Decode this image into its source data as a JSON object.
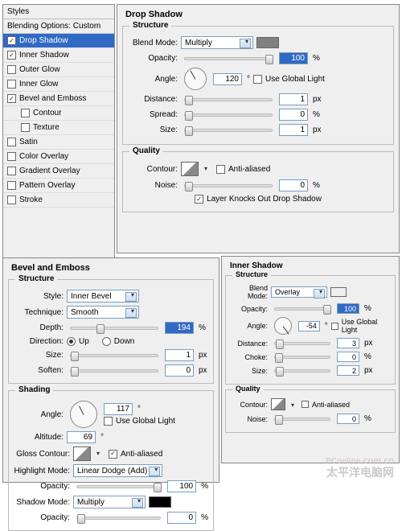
{
  "sidebar": {
    "header": "Styles",
    "blending": "Blending Options: Custom",
    "items": [
      {
        "label": "Drop Shadow",
        "checked": true,
        "selected": true,
        "indent": false
      },
      {
        "label": "Inner Shadow",
        "checked": true,
        "selected": false,
        "indent": false
      },
      {
        "label": "Outer Glow",
        "checked": false,
        "selected": false,
        "indent": false
      },
      {
        "label": "Inner Glow",
        "checked": false,
        "selected": false,
        "indent": false
      },
      {
        "label": "Bevel and Emboss",
        "checked": true,
        "selected": false,
        "indent": false
      },
      {
        "label": "Contour",
        "checked": false,
        "selected": false,
        "indent": true
      },
      {
        "label": "Texture",
        "checked": false,
        "selected": false,
        "indent": true
      },
      {
        "label": "Satin",
        "checked": false,
        "selected": false,
        "indent": false
      },
      {
        "label": "Color Overlay",
        "checked": false,
        "selected": false,
        "indent": false
      },
      {
        "label": "Gradient Overlay",
        "checked": false,
        "selected": false,
        "indent": false
      },
      {
        "label": "Pattern Overlay",
        "checked": false,
        "selected": false,
        "indent": false
      },
      {
        "label": "Stroke",
        "checked": false,
        "selected": false,
        "indent": false
      }
    ]
  },
  "dropShadow": {
    "title": "Drop Shadow",
    "structure": {
      "title": "Structure",
      "blendModeLabel": "Blend Mode:",
      "blendMode": "Multiply",
      "color": "#808080",
      "opacityLabel": "Opacity:",
      "opacity": "100",
      "pct": "%",
      "angleLabel": "Angle:",
      "angle": "120",
      "deg": "°",
      "useGlobalLabel": "Use Global Light",
      "useGlobal": false,
      "distanceLabel": "Distance:",
      "distance": "1",
      "spreadLabel": "Spread:",
      "spread": "0",
      "sizeLabel": "Size:",
      "size": "1",
      "px": "px"
    },
    "quality": {
      "title": "Quality",
      "contourLabel": "Contour:",
      "antiAliasedLabel": "Anti-aliased",
      "antiAliased": false,
      "noiseLabel": "Noise:",
      "noise": "0",
      "knockoutLabel": "Layer Knocks Out Drop Shadow",
      "knockout": true
    }
  },
  "bevel": {
    "title": "Bevel and Emboss",
    "structure": {
      "title": "Structure",
      "styleLabel": "Style:",
      "style": "Inner Bevel",
      "techLabel": "Technique:",
      "tech": "Smooth",
      "depthLabel": "Depth:",
      "depth": "194",
      "dirLabel": "Direction:",
      "up": "Up",
      "down": "Down",
      "sizeLabel": "Size:",
      "size": "1",
      "softenLabel": "Soften:",
      "soften": "0",
      "px": "px",
      "pct": "%"
    },
    "shading": {
      "title": "Shading",
      "angleLabel": "Angle:",
      "angle": "117",
      "useGlobalLabel": "Use Global Light",
      "useGlobal": false,
      "altitudeLabel": "Altitude:",
      "altitude": "69",
      "glossLabel": "Gloss Contour:",
      "antiAliasedLabel": "Anti-aliased",
      "antiAliased": true,
      "hlModeLabel": "Highlight Mode:",
      "hlMode": "Linear Dodge (Add)",
      "opacityLabel": "Opacity:",
      "hlOpacity": "100",
      "shModeLabel": "Shadow Mode:",
      "shMode": "Multiply",
      "shColor": "#000000",
      "shOpacity": "0",
      "pct": "%",
      "deg": "°"
    }
  },
  "innerShadow": {
    "title": "Inner Shadow",
    "structure": {
      "title": "Structure",
      "blendModeLabel": "Blend Mode:",
      "blendMode": "Overlay",
      "opacityLabel": "Opacity:",
      "opacity": "100",
      "angleLabel": "Angle:",
      "angle": "-54",
      "useGlobalLabel": "Use Global Light",
      "useGlobal": false,
      "distanceLabel": "Distance:",
      "distance": "3",
      "chokeLabel": "Choke:",
      "choke": "0",
      "sizeLabel": "Size:",
      "size": "2",
      "px": "px",
      "pct": "%",
      "deg": "°"
    },
    "quality": {
      "title": "Quality",
      "contourLabel": "Contour:",
      "antiAliasedLabel": "Anti-aliased",
      "antiAliased": false,
      "noiseLabel": "Noise:",
      "noise": "0",
      "pct": "%"
    }
  },
  "watermark": {
    "a": "PConline",
    "b": ".com.cn",
    "c": "太平洋电脑网"
  }
}
